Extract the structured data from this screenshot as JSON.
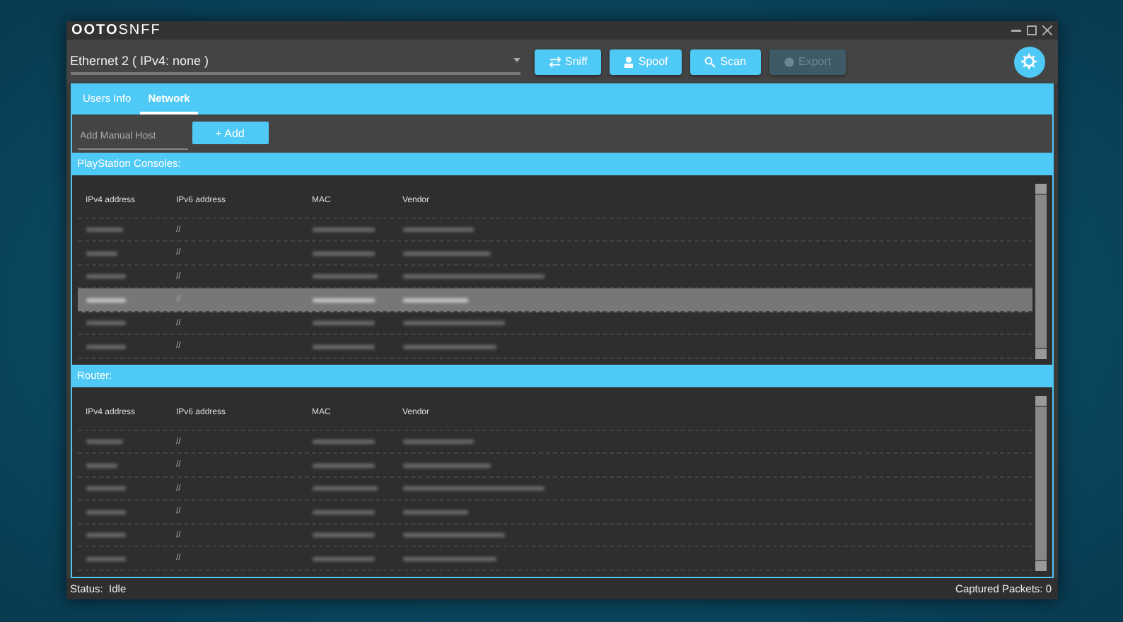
{
  "window": {
    "logo_bold": "OOTO",
    "logo_light": "SNFF"
  },
  "toolbar": {
    "interface": "Ethernet 2 ( IPv4: none )",
    "buttons": [
      {
        "kind": "sniff",
        "label": "Sniff",
        "disabled": false
      },
      {
        "kind": "spoof",
        "label": "Spoof",
        "disabled": false
      },
      {
        "kind": "scan",
        "label": "Scan",
        "disabled": false
      },
      {
        "kind": "export",
        "label": "Export",
        "disabled": true
      }
    ]
  },
  "tabs": [
    {
      "label": "Users Info",
      "selected": false
    },
    {
      "label": "Network",
      "selected": true
    }
  ],
  "manual_host": {
    "placeholder": "Add Manual Host",
    "button": "+ Add"
  },
  "sections": [
    {
      "title": "PlayStation Consoles:",
      "columns": [
        "IPv4 address",
        "IPv6 address",
        "MAC",
        "Vendor"
      ],
      "rows": [
        {
          "ipv6": "//",
          "selected": false
        },
        {
          "ipv6": "//",
          "selected": false
        },
        {
          "ipv6": "//",
          "selected": false
        },
        {
          "ipv6": "//",
          "selected": true
        },
        {
          "ipv6": "//",
          "selected": false
        },
        {
          "ipv6": "//",
          "selected": false
        }
      ]
    },
    {
      "title": "Router:",
      "columns": [
        "IPv4 address",
        "IPv6 address",
        "MAC",
        "Vendor"
      ],
      "rows": [
        {
          "ipv6": "//",
          "selected": false
        },
        {
          "ipv6": "//",
          "selected": false
        },
        {
          "ipv6": "//",
          "selected": false
        },
        {
          "ipv6": "//",
          "selected": false
        },
        {
          "ipv6": "//",
          "selected": false
        },
        {
          "ipv6": "//",
          "selected": false
        }
      ]
    }
  ],
  "status_bar": {
    "status_label": "Status:",
    "status": "Idle",
    "packets": "Captured Packets: 0"
  }
}
